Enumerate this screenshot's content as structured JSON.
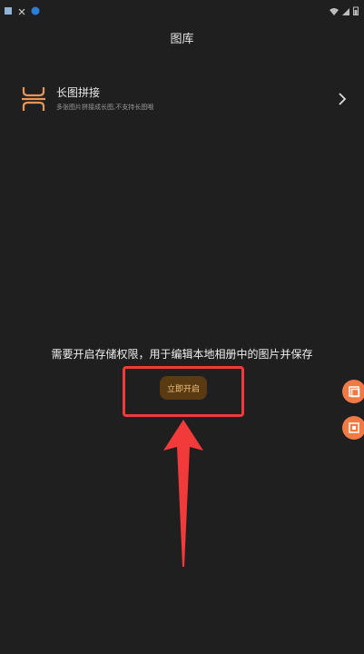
{
  "header": {
    "title": "图库"
  },
  "feature": {
    "title": "长图拼接",
    "subtitle": "多张图片拼接成长图,不支持长图哦",
    "icon": "long-image-stitch-icon"
  },
  "permission": {
    "message": "需要开启存储权限，用于编辑本地相册中的图片并保存",
    "button_label": "立即开启"
  },
  "colors": {
    "background": "#1f1f1f",
    "accent": "#f07a45",
    "highlight": "#f23a3a",
    "button_bg": "#5a3a12"
  }
}
